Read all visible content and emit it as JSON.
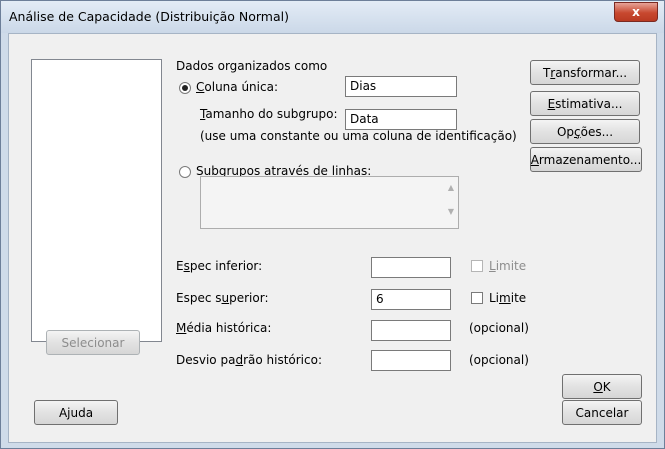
{
  "window": {
    "title": "Análise de Capacidade (Distribuição Normal)",
    "close_glyph": "x"
  },
  "buttons": {
    "transform": [
      "T",
      "r",
      "ansformar..."
    ],
    "estimate": [
      "",
      "E",
      "stimativa..."
    ],
    "options": [
      "Op",
      "ç",
      "ões..."
    ],
    "storage": [
      "",
      "A",
      "rmazenamento..."
    ],
    "select": "Selecionar",
    "help": "Ajuda",
    "ok": [
      "",
      "O",
      "K"
    ],
    "cancel": "Cancelar"
  },
  "data_org": {
    "heading": "Dados organizados como",
    "single_column": [
      "",
      "C",
      "oluna única:"
    ],
    "single_column_value": "Dias",
    "subgroup_size": [
      "",
      "T",
      "amanho do subgrupo:"
    ],
    "subgroup_size_value": "Data",
    "hint": "(use uma constante ou uma coluna de identificação)",
    "rows_subgroups": [
      "Su",
      "b",
      "grupos através de linhas:"
    ]
  },
  "specs": {
    "lower": [
      "E",
      "s",
      "pec inferior:"
    ],
    "lower_value": "",
    "lower_limit": [
      "",
      "L",
      "imite"
    ],
    "upper": [
      "Espec s",
      "u",
      "perior:"
    ],
    "upper_value": "6",
    "upper_limit": [
      "Li",
      "m",
      "ite"
    ],
    "hist_mean": [
      "",
      "M",
      "édia histórica:"
    ],
    "hist_mean_value": "",
    "hist_mean_note": "(opcional)",
    "hist_sd": [
      "Desvio pa",
      "d",
      "rão histórico:"
    ],
    "hist_sd_value": "",
    "hist_sd_note": "(opcional)"
  },
  "state": {
    "single_column_selected": true,
    "rows_subgroups_selected": false,
    "lower_limit_checked": false,
    "lower_limit_enabled": false,
    "upper_limit_checked": false
  }
}
